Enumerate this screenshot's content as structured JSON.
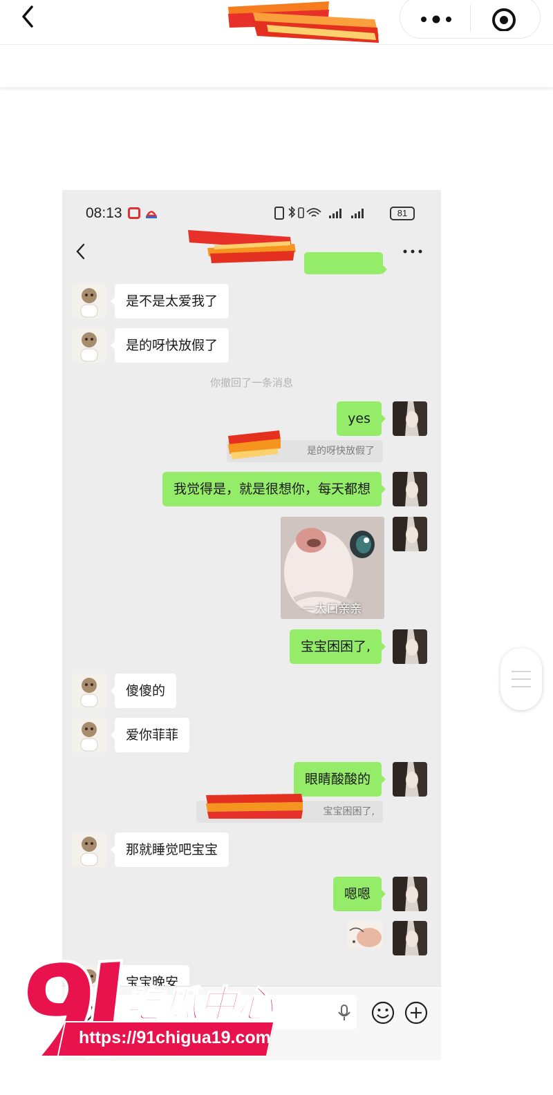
{
  "outer": {
    "back_icon": "chevron-left-icon",
    "more_icon": "more-dots-icon",
    "target_icon": "target-icon"
  },
  "status_bar": {
    "time": "08:13",
    "battery": "81"
  },
  "chat": {
    "back_icon": "chevron-left-icon",
    "more_icon": "more-dots-icon",
    "messages": [
      {
        "from": "other",
        "text": "是不是太爱我了"
      },
      {
        "from": "other",
        "text": "是的呀快放假了"
      },
      {
        "from": "system",
        "text": "你撤回了一条消息"
      },
      {
        "from": "me",
        "text": "yes"
      },
      {
        "from": "quote",
        "text": "是的呀快放假了"
      },
      {
        "from": "me",
        "text": "我觉得是，就是很想你，每天都想"
      },
      {
        "from": "me",
        "type": "sticker",
        "caption": "一大口亲亲"
      },
      {
        "from": "me",
        "text": "宝宝困困了,"
      },
      {
        "from": "other",
        "text": "傻傻的"
      },
      {
        "from": "other",
        "text": "爱你菲菲"
      },
      {
        "from": "me",
        "text": "眼睛酸酸的"
      },
      {
        "from": "quote",
        "text": "宝宝困困了,"
      },
      {
        "from": "other",
        "text": "那就睡觉吧宝宝"
      },
      {
        "from": "me",
        "text": "嗯嗯"
      },
      {
        "from": "me",
        "type": "sticker"
      },
      {
        "from": "other",
        "text": "宝宝晚安"
      }
    ]
  },
  "input_bar": {
    "voice_icon": "voice-icon",
    "mic_icon": "mic-icon",
    "emoji_icon": "emoji-icon",
    "plus_icon": "plus-icon"
  },
  "watermark": {
    "logo": "91吃瓜中心",
    "url": "https://91chigua19.com"
  },
  "colors": {
    "bubble_me": "#95ec69",
    "bubble_other": "#ffffff",
    "chat_bg": "#ededed",
    "watermark": "#e8134d"
  }
}
